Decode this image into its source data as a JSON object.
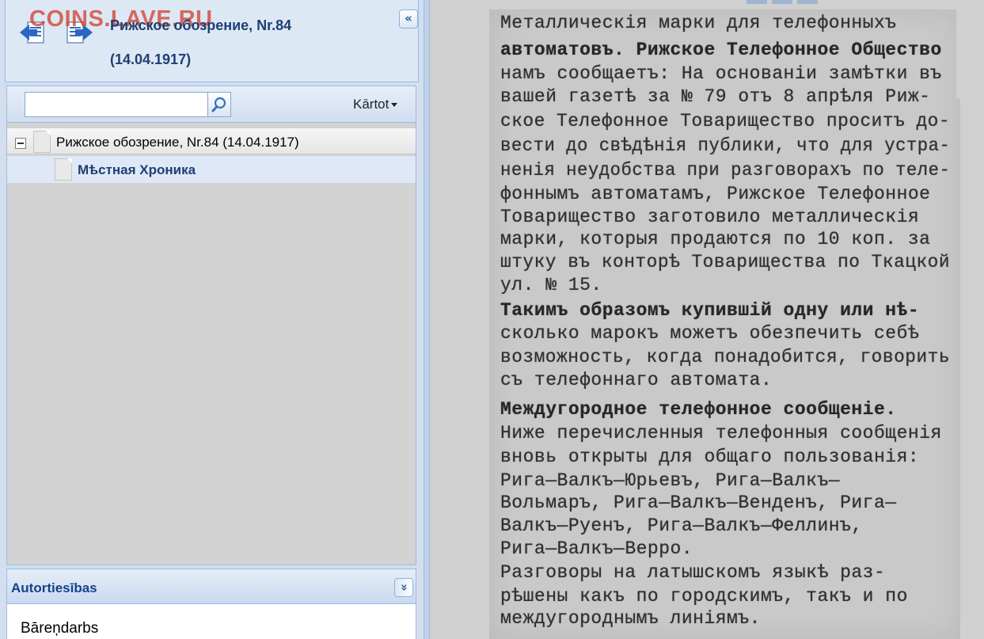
{
  "watermark": "COINS.LAVE.RU",
  "header": {
    "title": "Рижское обозрение, Nr.84",
    "date": "(14.04.1917)",
    "collapse_glyph": "«"
  },
  "toolbar": {
    "search_value": "",
    "search_placeholder": "",
    "kartot_label": "Kārtot"
  },
  "tree": {
    "root_label": "Рижское обозрение, Nr.84 (14.04.1917)",
    "child_label": "Мѣстная Хроника"
  },
  "copyright": {
    "title": "Autortiesības",
    "collapse_glyph": "»",
    "text": "Bāreņdarbs"
  },
  "icons": {
    "back": "back-arrow-icon",
    "forward": "forward-arrow-icon",
    "search": "magnifier-icon",
    "collapse_panel": "double-chevron-left-icon",
    "expand_panel": "double-chevron-down-icon",
    "tree_toggle": "minus-box-icon",
    "document": "page-icon"
  },
  "colors": {
    "title_blue": "#1f3f73",
    "panel_border": "#99bbe8",
    "watermark": "#d23c28"
  },
  "scan_text": [
    "Металлическія марки для телефонныхъ",
    "автоматовъ. Рижское Телефонное Общество",
    "намъ сообщаетъ: На основаніи замѣтки въ",
    "вашей газетѣ за № 79 отъ 8 апрѣля Риж-",
    "ское Телефонное Товарищество проситъ до-",
    "вести до свѣдѣнія публики, что для устра-",
    "ненія неудобства при разговорахъ по теле-",
    "фоннымъ автоматамъ, Рижское Телефонное",
    "Товарищество заготовило металлическія",
    "марки, которыя продаются по 10 коп. за",
    "штуку въ конторѣ Товарищества по Ткацкой",
    "ул. № 15.",
    "  Такимъ образомъ купившій одну или нѣ-",
    "сколько марокъ можетъ обезпечить себѣ",
    "возможность, когда понадобится, говорить",
    "съ телефоннаго автомата.",
    "  Междугородное телефонное сообщеніе.",
    "Ниже перечисленныя телефонныя сообщенія",
    "вновь открыты для общаго пользованія:",
    "  Рига—Валкъ—Юрьевъ, Рига—Валкъ—",
    "Вольмаръ, Рига—Валкъ—Венденъ, Рига—",
    "Валкъ—Руенъ, Рига—Валкъ—Феллинъ,",
    "Рига—Валкъ—Верро.",
    "  Разговоры на латышскомъ языкѣ раз-",
    "рѣшены какъ по городскимъ, такъ и по",
    "междугороднымъ линіямъ."
  ]
}
